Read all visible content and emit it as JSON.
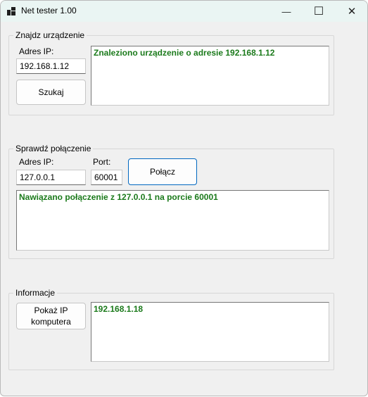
{
  "window": {
    "title": "Net tester 1.00",
    "min_glyph": "—",
    "max_glyph": "☐",
    "close_glyph": "✕"
  },
  "find_device": {
    "legend": "Znajdz urządzenie",
    "ip_label": "Adres IP:",
    "ip_value": "192.168.1.12",
    "search_button": "Szukaj",
    "result": "Znaleziono urządzenie o adresie 192.168.1.12"
  },
  "check_connection": {
    "legend": "Sprawdź połączenie",
    "ip_label": "Adres IP:",
    "ip_value": "127.0.0.1",
    "port_label": "Port:",
    "port_value": "60001",
    "connect_button": "Połącz",
    "result": "Nawiązano połączenie z 127.0.0.1 na porcie 60001"
  },
  "info": {
    "legend": "Informacje",
    "show_ip_button": "Pokaż IP komputera",
    "result": "192.168.1.18"
  },
  "colors": {
    "result_text": "#1b7a1b",
    "focus_border": "#0067c0",
    "window_bg": "#f0f0f0"
  }
}
